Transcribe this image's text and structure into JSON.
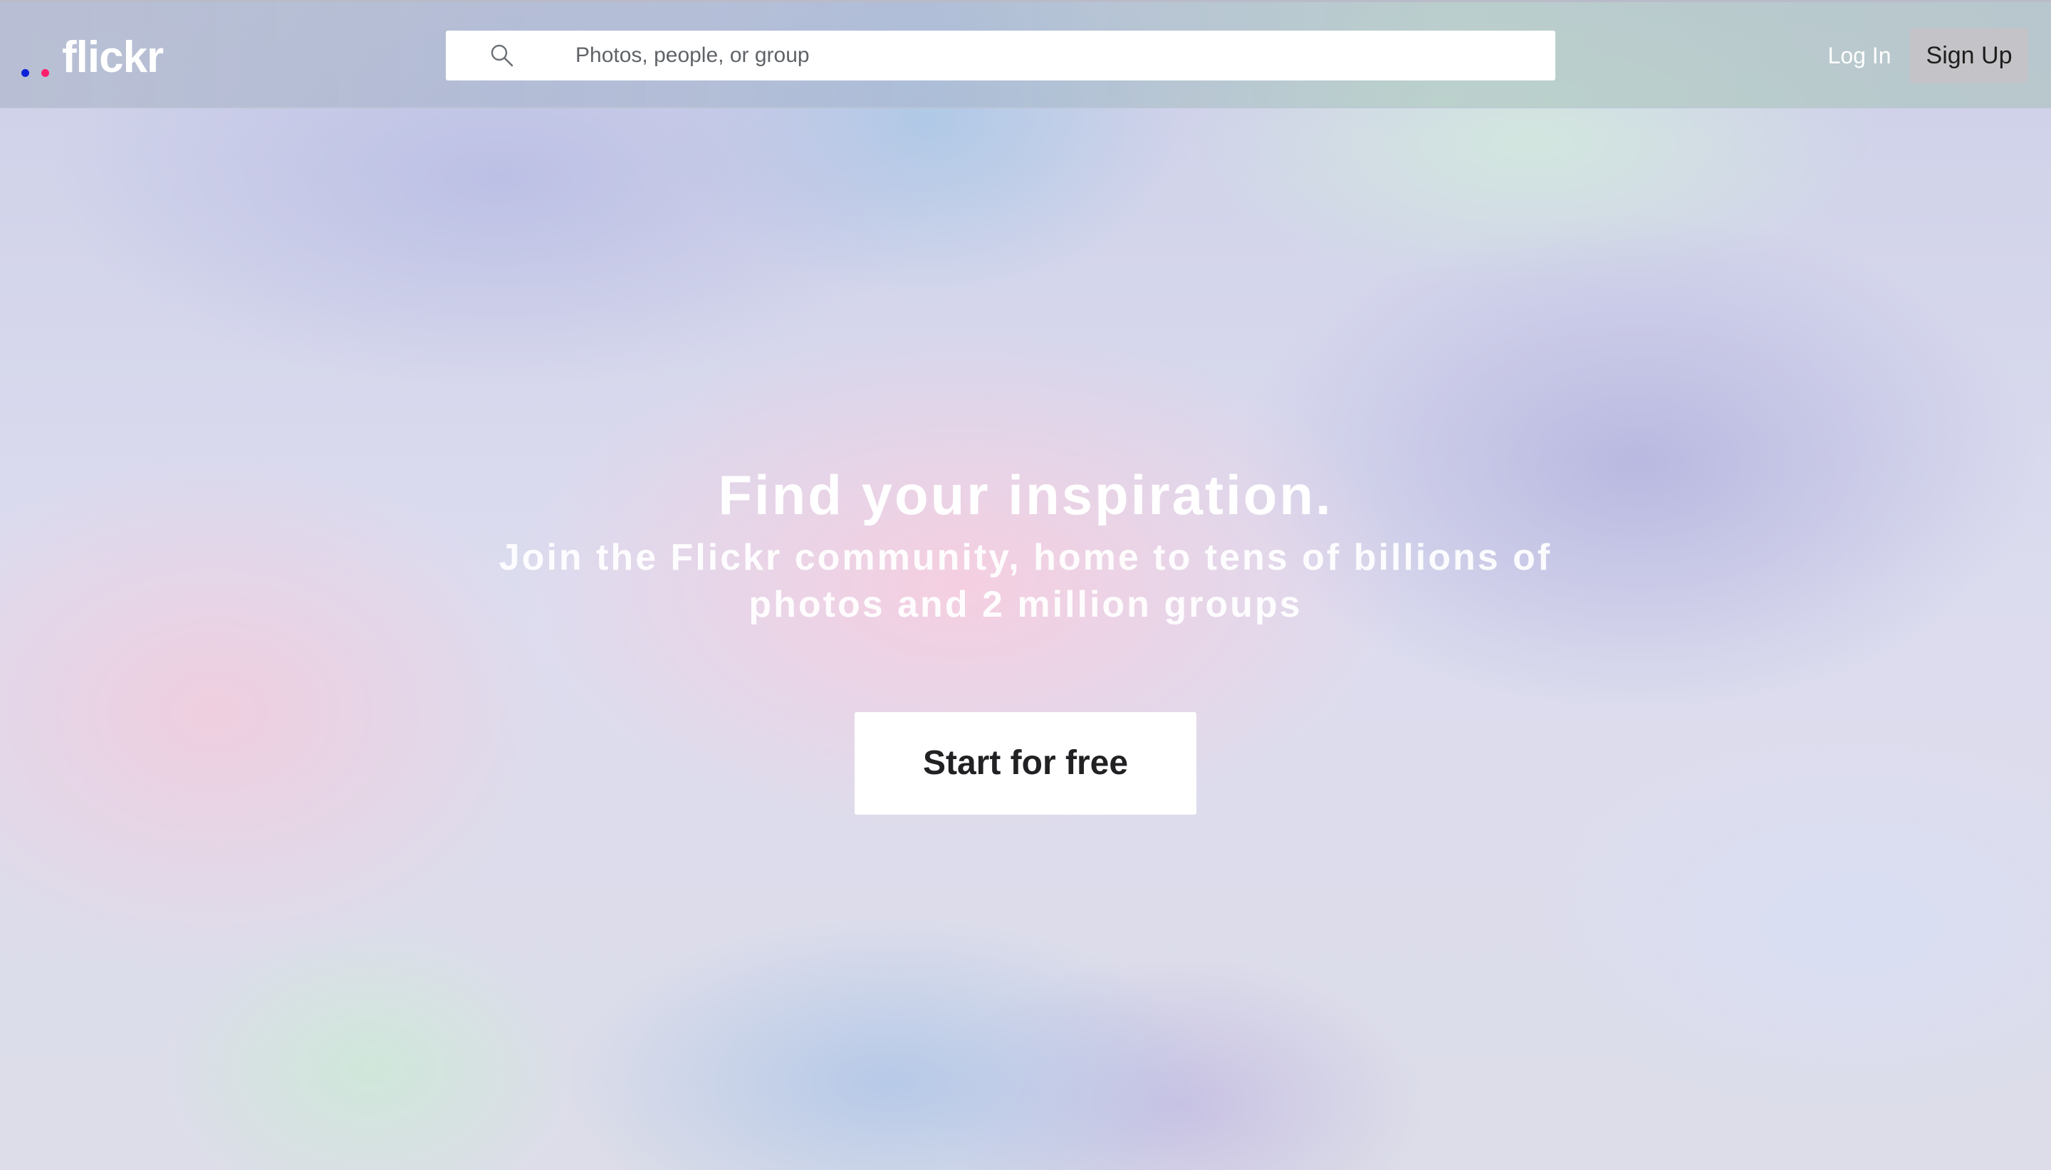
{
  "brand": {
    "name": "flickr",
    "dot_colors": [
      "#0e22d8",
      "#ff1f6c"
    ]
  },
  "search": {
    "placeholder": "Photos, people, or group",
    "icon": "search-icon"
  },
  "nav": {
    "login_label": "Log In",
    "signup_label": "Sign Up"
  },
  "hero": {
    "title": "Find your inspiration.",
    "subtitle": "Join the Flickr community, home to tens of billions of photos and 2 million groups",
    "cta_label": "Start for free"
  }
}
